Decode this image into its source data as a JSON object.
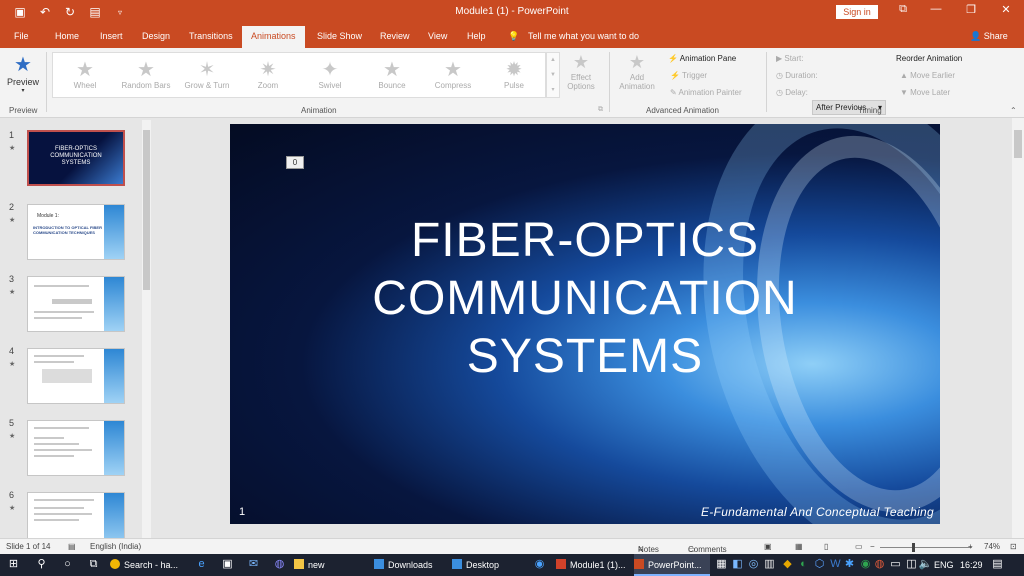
{
  "titlebar": {
    "doc_title": "Module1 (1) - PowerPoint",
    "signin": "Sign in",
    "minimize": "—",
    "restore": "❐",
    "close": "✕",
    "ribbon_display": "⧉"
  },
  "tabs": [
    "File",
    "Home",
    "Insert",
    "Design",
    "Transitions",
    "Animations",
    "Slide Show",
    "Review",
    "View",
    "Help"
  ],
  "active_tab": "Animations",
  "tellme": "Tell me what you want to do",
  "share": "Share",
  "ribbon": {
    "preview": {
      "label": "Preview",
      "group": "Preview"
    },
    "animations": [
      "Wheel",
      "Random Bars",
      "Grow & Turn",
      "Zoom",
      "Swivel",
      "Bounce",
      "Compress",
      "Pulse"
    ],
    "effect_options": [
      "Effect",
      "Options"
    ],
    "animation_group": "Animation",
    "add_animation": [
      "Add",
      "Animation"
    ],
    "animation_pane": "Animation Pane",
    "trigger": "Trigger",
    "animation_painter": "Animation Painter",
    "advanced_group": "Advanced Animation",
    "start_label": "Start:",
    "start_value": "After Previous",
    "duration_label": "Duration:",
    "delay_label": "Delay:",
    "timing_group": "Timing",
    "reorder": "Reorder Animation",
    "move_earlier": "Move Earlier",
    "move_later": "Move Later"
  },
  "thumbnails": [
    {
      "num": "1",
      "title": [
        "FIBER-OPTICS",
        "COMMUNICATION",
        "SYSTEMS"
      ]
    },
    {
      "num": "2",
      "module": "Module 1:",
      "heading": [
        "INTRODUCTION TO OPTICAL FIBER",
        "COMMUNICATION TECHNIQUES"
      ]
    },
    {
      "num": "3"
    },
    {
      "num": "4"
    },
    {
      "num": "5"
    },
    {
      "num": "6"
    }
  ],
  "slide": {
    "title_lines": [
      "FIBER-OPTICS",
      "COMMUNICATION",
      "SYSTEMS"
    ],
    "anim_tag": "0",
    "number": "1",
    "footer": "E-Fundamental And Conceptual Teaching"
  },
  "status": {
    "slide_info": "Slide 1 of 14",
    "language": "English (India)",
    "notes": "Notes",
    "comments": "Comments",
    "zoom": "74%",
    "zoom_level_percent": 74
  },
  "taskbar": {
    "search": "Search - ha...",
    "new": "new",
    "downloads": "Downloads",
    "desktop": "Desktop",
    "module": "Module1 (1)...",
    "powerpoint": "PowerPoint...",
    "lang": "ENG",
    "time": "16:29"
  }
}
